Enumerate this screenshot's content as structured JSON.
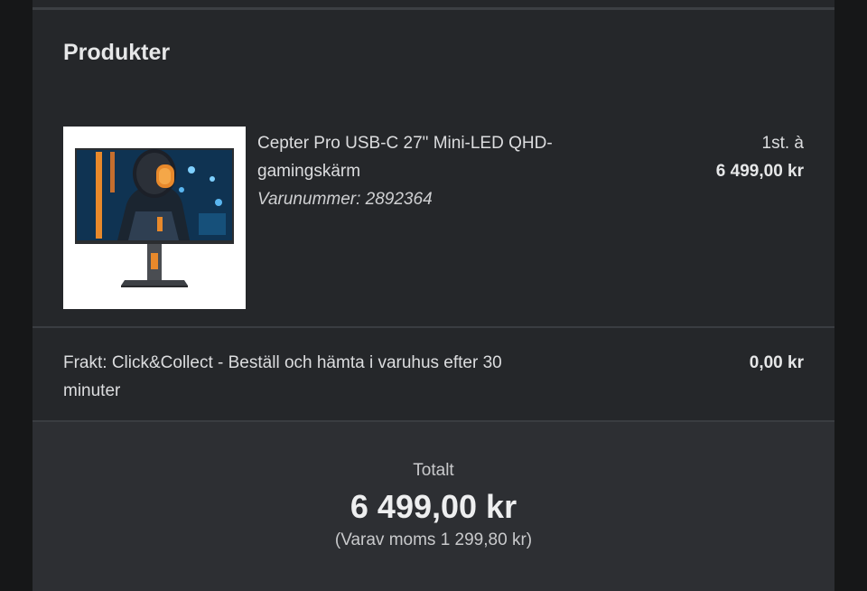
{
  "products": {
    "title": "Produkter",
    "item": {
      "image_icon": "monitor-product-image",
      "name": "Cepter Pro USB-C 27\" Mini-LED QHD-gamingskärm",
      "sku": "Varunummer: 2892364",
      "quantity": "1st. à",
      "unit_price": "6 499,00 kr"
    }
  },
  "shipping": {
    "text": "Frakt: Click&Collect - Beställ och hämta i varuhus efter 30 minuter",
    "price": "0,00 kr"
  },
  "total": {
    "label": "Totalt",
    "amount": "6 499,00 kr",
    "vat": "(Varav moms 1 299,80 kr)"
  },
  "colors": {
    "background": "#161718",
    "panel": "#25272a",
    "total_panel": "#2d2f33",
    "text": "#e4e5e6",
    "accent_orange": "#e8892b"
  }
}
